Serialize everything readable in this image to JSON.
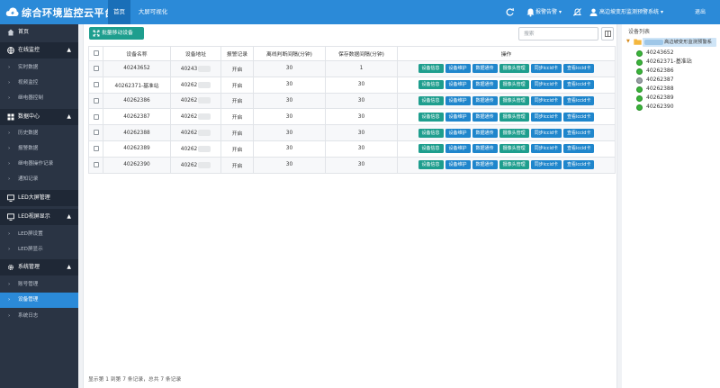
{
  "header": {
    "title": "综合环境监控云平台",
    "tabs": [
      {
        "label": "首页",
        "active": true
      },
      {
        "label": "大屏可视化",
        "active": false
      }
    ],
    "alarm_label": "报警告警",
    "org_label": "高边坡变形监测预警系统",
    "logout_label": "退出",
    "brand_color": "#2b8ad8"
  },
  "sidebar": {
    "home": "首页",
    "groups": [
      {
        "label": "在线监控",
        "icon": "globe-icon",
        "expanded": true,
        "items": [
          "实时数据",
          "视频监控",
          "继电器控制"
        ]
      },
      {
        "label": "数据中心",
        "icon": "grid-icon",
        "expanded": true,
        "items": [
          "历史数据",
          "报警数据",
          "继电器操作记录",
          "通知记录"
        ]
      },
      {
        "label": "LED大屏管理",
        "icon": "monitor-icon",
        "expanded": false,
        "items": []
      },
      {
        "label": "LED视屏显示",
        "icon": "monitor-icon",
        "expanded": true,
        "items": [
          "LED屏设置",
          "LED屏显示"
        ]
      },
      {
        "label": "系统管理",
        "icon": "gear-icon",
        "expanded": true,
        "items": [
          "账号管理",
          "设备管理",
          "系统日志"
        ]
      }
    ],
    "active_item": "设备管理"
  },
  "toolbar": {
    "batch_label": "批量移动设备",
    "search_placeholder": "搜索"
  },
  "table": {
    "columns": [
      "设备名称",
      "设备地址",
      "报警记录",
      "离线判断间隔(分钟)",
      "保存数据间隔(分钟)",
      "操作"
    ],
    "rows": [
      {
        "name": "40243652",
        "addr": "40243",
        "alarm": "开启",
        "offline": "30",
        "save": "1"
      },
      {
        "name": "40262371-基准站",
        "addr": "40262",
        "alarm": "开启",
        "offline": "30",
        "save": "30"
      },
      {
        "name": "40262386",
        "addr": "40262",
        "alarm": "开启",
        "offline": "30",
        "save": "30"
      },
      {
        "name": "40262387",
        "addr": "40262",
        "alarm": "开启",
        "offline": "30",
        "save": "30"
      },
      {
        "name": "40262388",
        "addr": "40262",
        "alarm": "开启",
        "offline": "30",
        "save": "30"
      },
      {
        "name": "40262389",
        "addr": "40262",
        "alarm": "开启",
        "offline": "30",
        "save": "30"
      },
      {
        "name": "40262390",
        "addr": "40262",
        "alarm": "开启",
        "offline": "30",
        "save": "30"
      }
    ],
    "actions": [
      {
        "label": "设备信息",
        "color": "#1e9e8e"
      },
      {
        "label": "设备维护",
        "color": "#1f86cc"
      },
      {
        "label": "数据通传",
        "color": "#1f86cc"
      },
      {
        "label": "摄像头管理",
        "color": "#1e9e8e"
      },
      {
        "label": "同步iccid卡",
        "color": "#1f86cc"
      },
      {
        "label": "查看iccid卡",
        "color": "#1f86cc"
      }
    ]
  },
  "footer": {
    "summary": "显示第 1 到第 7 条记录，总共 7 条记录"
  },
  "device_tree": {
    "title": "设备列表",
    "root_label": "高边坡变形监测预警系",
    "items": [
      {
        "label": "40243652",
        "status": "online"
      },
      {
        "label": "40262371-基准站",
        "status": "online"
      },
      {
        "label": "40262386",
        "status": "online"
      },
      {
        "label": "40262387",
        "status": "offline"
      },
      {
        "label": "40262388",
        "status": "online"
      },
      {
        "label": "40262389",
        "status": "online"
      },
      {
        "label": "40262390",
        "status": "online"
      }
    ]
  }
}
